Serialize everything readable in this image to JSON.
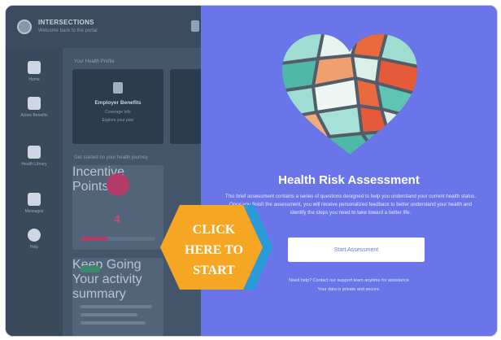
{
  "header": {
    "user_name": "INTERSECTIONS",
    "user_subtitle": "Welcome back to the portal"
  },
  "sidebar": {
    "items": [
      {
        "label": "Home",
        "icon": "home-icon"
      },
      {
        "label": "Active Benefits",
        "icon": "clipboard-icon"
      },
      {
        "label": "Health Library",
        "icon": "book-icon"
      },
      {
        "label": "Messages",
        "icon": "inbox-icon"
      },
      {
        "label": "Help",
        "icon": "info-icon"
      }
    ]
  },
  "main": {
    "section_title": "Your Health Profile",
    "card1": {
      "title": "Employer Benefits",
      "subtitle": "Coverage Info",
      "detail": "Explore your plan"
    },
    "section2_title": "Get started on your health journey",
    "stat": {
      "label": "Incentive Points",
      "value": "4"
    },
    "panel": {
      "title": "Keep Going",
      "subtitle": "Your activity summary"
    }
  },
  "overlay": {
    "title": "Health Risk Assessment",
    "description": "This brief assessment contains a series of questions designed to help you understand your current health status. Once you finish the assessment, you will receive personalized feedback to better understand your health and identify the steps you need to take toward a better life.",
    "start_button": "Start Assessment",
    "footer_line1": "Need help? Contact our support team anytime for assistance",
    "footer_line2": "Your data is private and secure."
  },
  "cta": {
    "line1": "CLICK",
    "line2": "HERE TO",
    "line3": "START"
  },
  "colors": {
    "overlay": "#6a75ea",
    "cta_orange": "#f5a623",
    "cta_blue": "#2a9bd8"
  }
}
